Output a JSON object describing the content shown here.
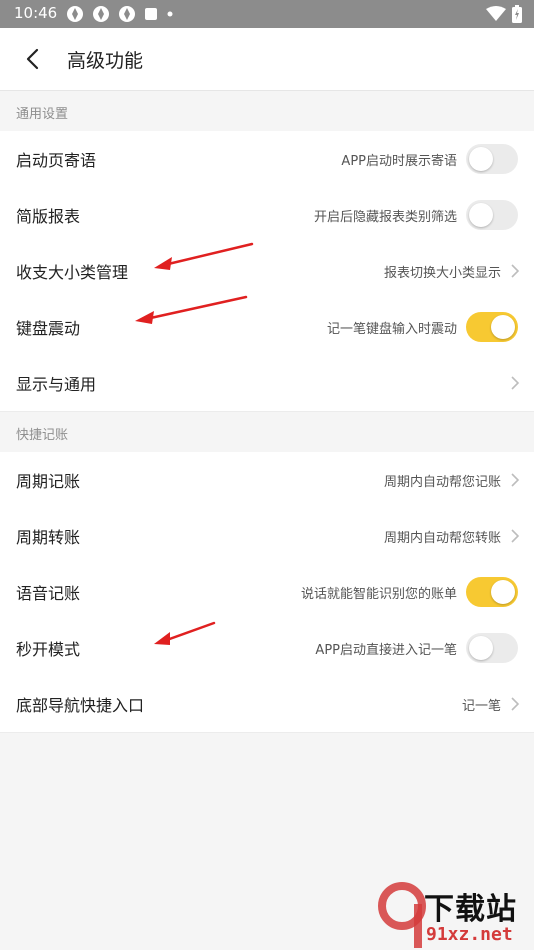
{
  "status": {
    "time": "10:46"
  },
  "header": {
    "title": "高级功能"
  },
  "sections": [
    {
      "title": "通用设置",
      "rows": [
        {
          "label": "启动页寄语",
          "desc": "APP启动时展示寄语",
          "control": "toggle",
          "on": false
        },
        {
          "label": "简版报表",
          "desc": "开启后隐藏报表类别筛选",
          "control": "toggle",
          "on": false
        },
        {
          "label": "收支大小类管理",
          "desc": "报表切换大小类显示",
          "control": "chevron"
        },
        {
          "label": "键盘震动",
          "desc": "记一笔键盘输入时震动",
          "control": "toggle",
          "on": true
        },
        {
          "label": "显示与通用",
          "desc": "",
          "control": "chevron"
        }
      ]
    },
    {
      "title": "快捷记账",
      "rows": [
        {
          "label": "周期记账",
          "desc": "周期内自动帮您记账",
          "control": "chevron"
        },
        {
          "label": "周期转账",
          "desc": "周期内自动帮您转账",
          "control": "chevron"
        },
        {
          "label": "语音记账",
          "desc": "说话就能智能识别您的账单",
          "control": "toggle",
          "on": true
        },
        {
          "label": "秒开模式",
          "desc": "APP启动直接进入记一笔",
          "control": "toggle",
          "on": false
        },
        {
          "label": "底部导航快捷入口",
          "desc": "记一笔",
          "control": "chevron"
        }
      ]
    }
  ],
  "colors": {
    "toggle_on": "#f7c932",
    "toggle_off": "#ebebeb",
    "annotation_arrow": "#e02020"
  },
  "watermark": {
    "text_cn": "下载站",
    "text_url": "91xz.net"
  }
}
